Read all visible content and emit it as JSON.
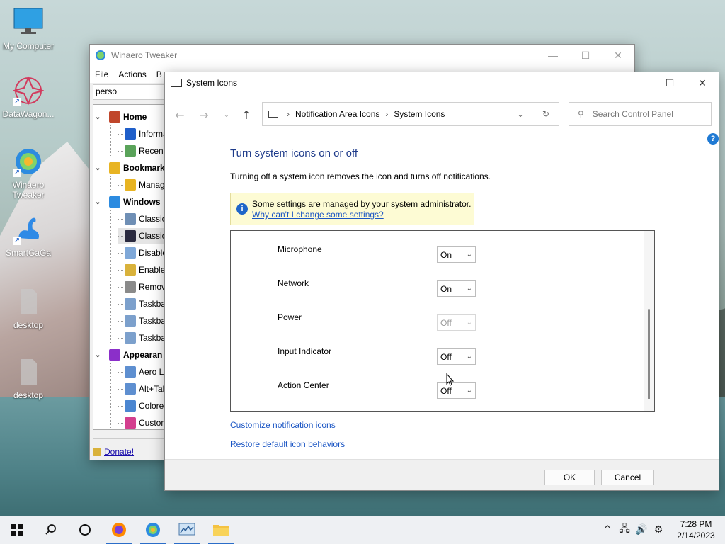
{
  "desktop": {
    "icons": [
      {
        "label": "My Computer"
      },
      {
        "label": "DataWagon..."
      },
      {
        "label": "Winaero Tweaker"
      },
      {
        "label": "SmartGaGa"
      },
      {
        "label": "desktop"
      },
      {
        "label": "desktop"
      }
    ]
  },
  "winaero": {
    "title": "Winaero Tweaker",
    "menu": [
      "File",
      "Actions",
      "B"
    ],
    "search_value": "perso",
    "tree": [
      {
        "label": "Home",
        "bold": true,
        "color": "#c0462b"
      },
      {
        "label": "Informa",
        "color": "#1f5ec9"
      },
      {
        "label": "Recent",
        "color": "#5aa35a"
      },
      {
        "label": "Bookmark",
        "bold": true,
        "color": "#e8b423"
      },
      {
        "label": "Manage",
        "color": "#e8b423"
      },
      {
        "label": "Windows",
        "bold": true,
        "color": "#2c8be0"
      },
      {
        "label": "Classic",
        "color": "#6f8fb5"
      },
      {
        "label": "Classic",
        "color": "#2a2a3f"
      },
      {
        "label": "Disable",
        "color": "#7fa8d8"
      },
      {
        "label": "Enable",
        "color": "#d9b23b"
      },
      {
        "label": "Remov",
        "color": "#8a8a8a"
      },
      {
        "label": "Taskba",
        "color": "#7ca0cc"
      },
      {
        "label": "Taskba",
        "color": "#7ca0cc"
      },
      {
        "label": "Taskba",
        "color": "#7ca0cc"
      },
      {
        "label": "Appearan",
        "bold": true,
        "color": "#8b2fc9"
      },
      {
        "label": "Aero Lit",
        "color": "#5e8fd0"
      },
      {
        "label": "Alt+Tab",
        "color": "#5e8fd0"
      },
      {
        "label": "Colored",
        "color": "#4b86d1"
      },
      {
        "label": "Custom",
        "color": "#d33f8e"
      }
    ],
    "donate": "Donate!"
  },
  "sysicons": {
    "title": "System Icons",
    "breadcrumb": [
      "Notification Area Icons",
      "System Icons"
    ],
    "search_placeholder": "Search Control Panel",
    "heading": "Turn system icons on or off",
    "description": "Turning off a system icon removes the icon and turns off notifications.",
    "info_line1": "Some settings are managed by your system administrator.",
    "info_link": "Why can't I change some settings?",
    "items": [
      {
        "label": "Microphone",
        "value": "On",
        "enabled": true
      },
      {
        "label": "Network",
        "value": "On",
        "enabled": true
      },
      {
        "label": "Power",
        "value": "Off",
        "enabled": false
      },
      {
        "label": "Input Indicator",
        "value": "Off",
        "enabled": true
      },
      {
        "label": "Action Center",
        "value": "Off",
        "enabled": true
      }
    ],
    "link_customize": "Customize notification icons",
    "link_restore": "Restore default icon behaviors",
    "ok": "OK",
    "cancel": "Cancel"
  },
  "taskbar": {
    "time": "7:28 PM",
    "date": "2/14/2023"
  }
}
